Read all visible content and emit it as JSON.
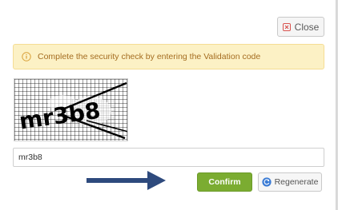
{
  "dialog": {
    "close_label": "Close",
    "close_icon": "close-square-icon",
    "alert": {
      "icon": "info-circle-icon",
      "text": "Complete the security check by entering the Validation code"
    },
    "captcha": {
      "text": "mr3b8"
    },
    "validation_input": {
      "value": "mr3b8",
      "placeholder": ""
    },
    "confirm_label": "Confirm",
    "regenerate_label": "Regenerate",
    "regenerate_icon": "refresh-icon"
  },
  "colors": {
    "alert_bg": "#fcf1c5",
    "alert_text": "#a56d21",
    "close_icon": "#d9534f",
    "confirm_bg": "#7bac31",
    "arrow": "#2e4a7d",
    "regenerate_icon": "#3a7bd5"
  }
}
